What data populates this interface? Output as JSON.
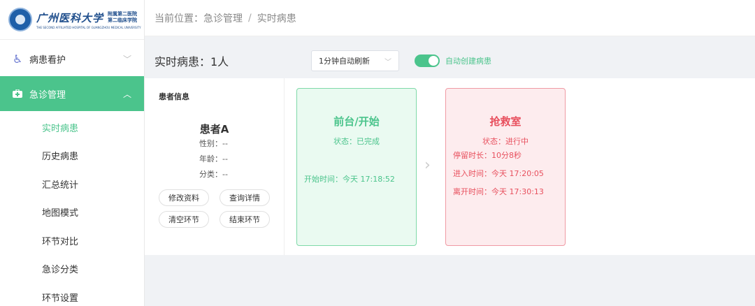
{
  "logo": {
    "name": "广州医科大学",
    "sub_line1": "附属第二医院",
    "sub_line2": "第二临床学院",
    "english": "THE SECOND AFFILIATED HOSPITAL OF GUANGZHOU MEDICAL UNIVERSITY"
  },
  "sidebar": {
    "groups": [
      {
        "label": "病患看护",
        "icon": "wheelchair-icon"
      },
      {
        "label": "急诊管理",
        "icon": "medical-kit-icon"
      }
    ],
    "items": [
      {
        "label": "实时病患"
      },
      {
        "label": "历史病患"
      },
      {
        "label": "汇总统计"
      },
      {
        "label": "地图模式"
      },
      {
        "label": "环节对比"
      },
      {
        "label": "急诊分类"
      },
      {
        "label": "环节设置"
      }
    ]
  },
  "breadcrumb": {
    "prefix": "当前位置：",
    "items": [
      "急诊管理",
      "实时病患"
    ],
    "separator": "/"
  },
  "toolbar": {
    "count_text": "实时病患：1人",
    "refresh_select": "1分钟自动刷新",
    "toggle_label": "自动创建病患",
    "toggle_on": true
  },
  "patient": {
    "heading": "患者信息",
    "name": "患者A",
    "gender": "性别：--",
    "age": "年龄：--",
    "category": "分类：--",
    "buttons": {
      "edit": "修改资料",
      "detail": "查询详情",
      "clear": "清空环节",
      "end": "结束环节"
    }
  },
  "stages": [
    {
      "title": "前台/开始",
      "status": "状态：已完成",
      "start": "开始时间：今天 17:18:52"
    },
    {
      "title": "抢救室",
      "status": "状态：进行中",
      "duration": "停留时长：10分8秒",
      "enter": "进入时间：今天 17:20:05",
      "leave": "离开时间：今天 17:30:13"
    }
  ],
  "colors": {
    "accent": "#4bc48c",
    "danger": "#e8505e"
  }
}
